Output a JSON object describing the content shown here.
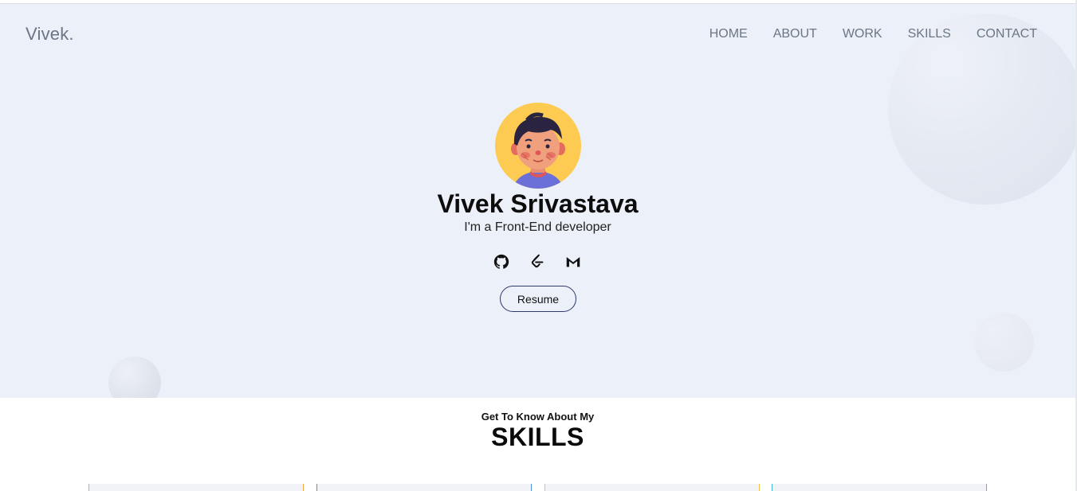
{
  "brand": {
    "logo": "Vivek."
  },
  "nav": {
    "items": [
      {
        "label": "HOME"
      },
      {
        "label": "ABOUT"
      },
      {
        "label": "WORK"
      },
      {
        "label": "SKILLS"
      },
      {
        "label": "CONTACT"
      }
    ]
  },
  "hero": {
    "name": "Vivek Srivastava",
    "tagline": "I'm a Front-End developer",
    "socials": [
      {
        "icon": "github-icon"
      },
      {
        "icon": "leetcode-icon"
      },
      {
        "icon": "gmail-icon"
      }
    ],
    "resume_label": "Resume"
  },
  "skills": {
    "subtitle": "Get To Know About My",
    "title": "SKILLS"
  },
  "colors": {
    "hero_bg": "#ecf0f8",
    "nav_text": "#6b7685",
    "avatar_bg": "#fecb52",
    "resume_border": "#2e3a6e"
  }
}
